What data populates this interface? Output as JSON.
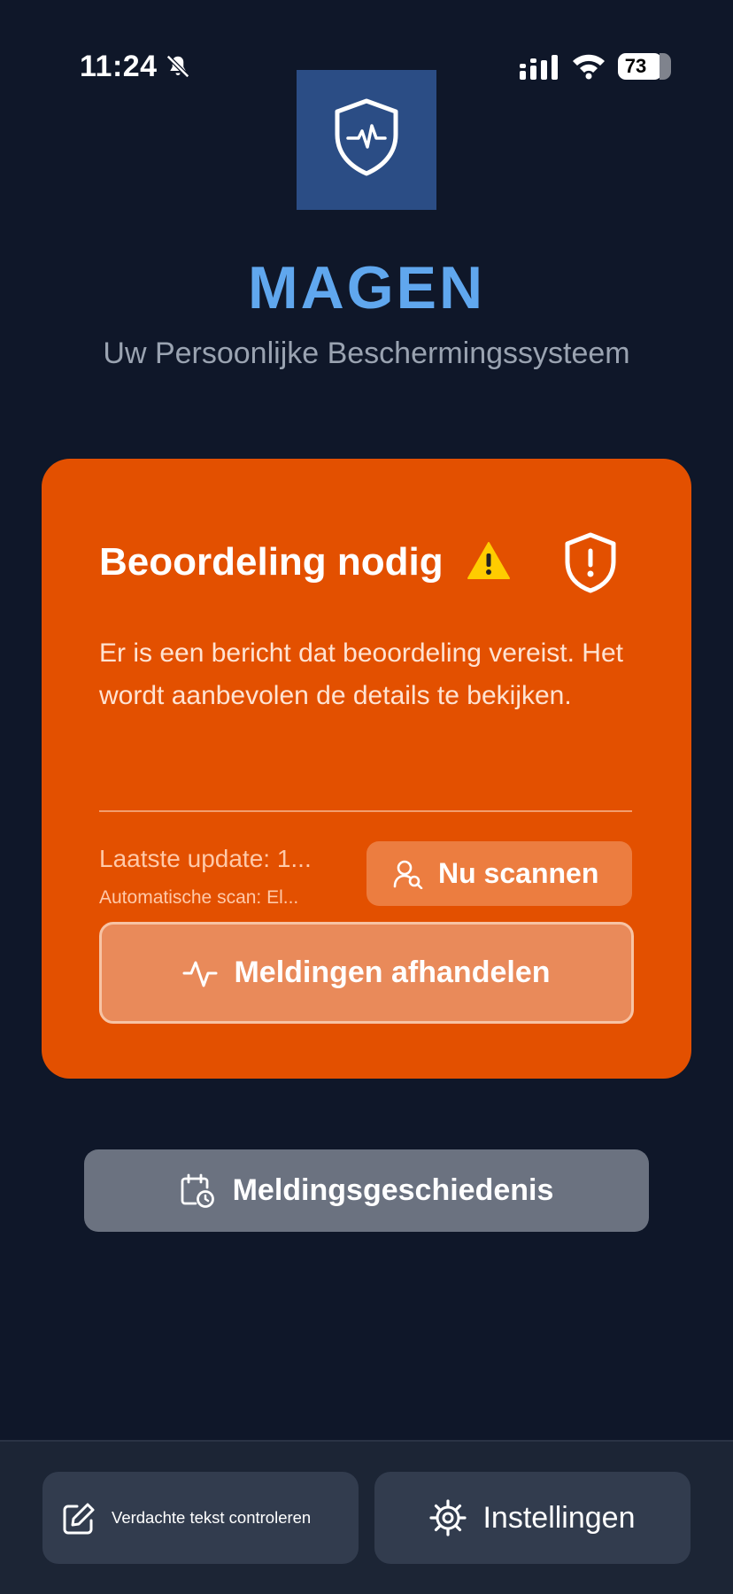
{
  "status_bar": {
    "time": "11:24",
    "battery_level": "73",
    "icons": [
      "bell-slash-icon",
      "cellular-signal-icon",
      "wifi-icon",
      "battery-icon"
    ]
  },
  "header": {
    "logo_icon": "shield-heartbeat-icon",
    "title": "MAGEN",
    "subtitle": "Uw Persoonlijke Beschermingssysteem"
  },
  "alert_card": {
    "title": "Beoordeling nodig",
    "title_icon": "warning-icon",
    "status_icon": "shield-alert-icon",
    "message": "Er is een bericht dat beoordeling vereist. Het wordt aanbevolen de details te bekijken.",
    "last_update": "Laatste update: 1...",
    "auto_scan": "Automatische scan: El...",
    "scan_button_label": "Nu scannen",
    "handle_button_label": "Meldingen afhandelen"
  },
  "history_button_label": "Meldingsgeschiedenis",
  "bottom_bar": {
    "check_text_label": "Verdachte tekst controleren",
    "settings_label": "Instellingen"
  },
  "colors": {
    "background": "#0f1729",
    "accent_title": "#60a7ee",
    "alert_orange": "#e35000",
    "logo_blue": "#2b4d85"
  }
}
